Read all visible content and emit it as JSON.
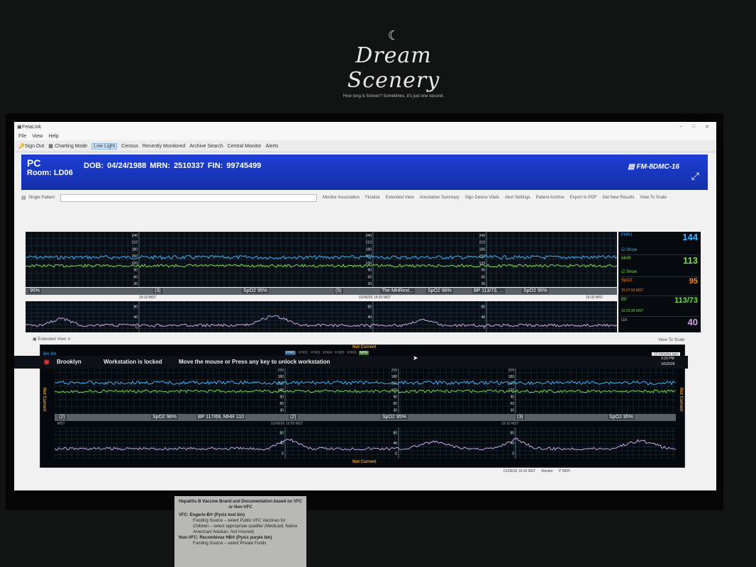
{
  "watermark": {
    "moon": "☾",
    "name": "Dream Scenery",
    "tagline": "How long is forever? Sometimes, it's just one second."
  },
  "window": {
    "title": "FetaLink",
    "menu": [
      "File",
      "View",
      "Help"
    ]
  },
  "toolbar": [
    {
      "label": "Sign Out",
      "icon": "key-icon"
    },
    {
      "label": "Charting Mode",
      "icon": "chart-icon"
    },
    {
      "label": "Low Light",
      "icon": "",
      "active": true
    },
    {
      "label": "Census",
      "icon": ""
    },
    {
      "label": "Recently Monitored",
      "icon": ""
    },
    {
      "label": "Archive Search",
      "icon": ""
    },
    {
      "label": "Central Monitor",
      "icon": ""
    },
    {
      "label": "Alerts",
      "icon": ""
    }
  ],
  "patient": {
    "name": "PC",
    "room": "Room: LD06",
    "ids": "DOB: 04/24/1988  MRN: 2510337  FIN: 99745499",
    "monitor": "FM-8DMC-16"
  },
  "subbar": {
    "single": "Single Patient",
    "items": [
      "Monitor Association",
      "Finalize",
      "Extended View",
      "Annotation Summary",
      "Sign Device Vitals",
      "Alert Settings",
      "Patient Archive",
      "Export to PDF",
      "Get New Results",
      "View To Scale"
    ]
  },
  "main_trace": {
    "fhr_ticks": [
      "240",
      "210",
      "180",
      "150",
      "120",
      "90",
      "60",
      "30"
    ],
    "ua_ticks": [
      "80",
      "40",
      "0"
    ],
    "labels": [
      "95%",
      "(3)",
      "SpO2  95%",
      "(5)",
      "The MHRext...",
      "SpO2  96%",
      "BP  113/73, ...",
      "SpO2  95%"
    ],
    "times": [
      "15:10 MST",
      "01/06/26 15:20 MST",
      "15:30 MST"
    ]
  },
  "sidebar": {
    "fhr1": {
      "label": "FHR1",
      "value": "144",
      "show": "Show"
    },
    "mhr": {
      "label": "MHR",
      "value": "113",
      "show": "Show"
    },
    "spo2": {
      "label": "SpO2",
      "value": "95",
      "time": "15:27:00 MST"
    },
    "bp": {
      "label": "BP",
      "value": "113/73",
      "time": "15:25:30 MST"
    },
    "ua": {
      "label": "UA",
      "value": "40"
    }
  },
  "extended_view": {
    "tab": "Extended View",
    "scale": "View To Scale",
    "not_current": "Not Current",
    "speed": "6m 3m",
    "channels": [
      "FHR1",
      "FHR2",
      "FHR3",
      "FHR4",
      "FHR5",
      "FHR6",
      "MHR"
    ],
    "ago": "12 minutes ago",
    "labels": [
      "(2)",
      "SpO2  96%",
      "BP  117/69, MHR  110",
      "(2)",
      "SpO2  95%",
      "(3)",
      "SpO2  95%"
    ],
    "times": [
      "MST",
      "01/06/26 15:00 MST",
      "15:10 MST"
    ]
  },
  "status": {
    "datetime": "01/06/26 15:30 MST",
    "mode": "Monitor",
    "device": "P 5805"
  },
  "taskbar": {
    "user": "Brooklyn",
    "locked": "Workstation is locked",
    "message": "Move the mouse or Press any key to unlock workstation",
    "time": "3:33 PM",
    "date": "1/6/2026"
  },
  "paper": {
    "title": "Hepatitis B Vaccine Brand and Documentation based on VFC or Non-VFC",
    "vfc": "VFC: Engerix-B® (Pyxis tool bin)",
    "vfc_items": [
      "Funding Source – select Public VFC Vaccines for Children – select appropriate qualifier (Medicaid, Native American/ Alaskan, Not Insured)"
    ],
    "nonvfc": "Non-VFC: Recombivax HB® (Pyxis purple bin)",
    "nonvfc_item": "Funding Source – select Private Funds"
  },
  "colors": {
    "fhr": "#3fb6ff",
    "mhr": "#6ee04a",
    "ua": "#c9a6e6",
    "banner": "#1d3fd6",
    "not_current": "#f0a020"
  }
}
